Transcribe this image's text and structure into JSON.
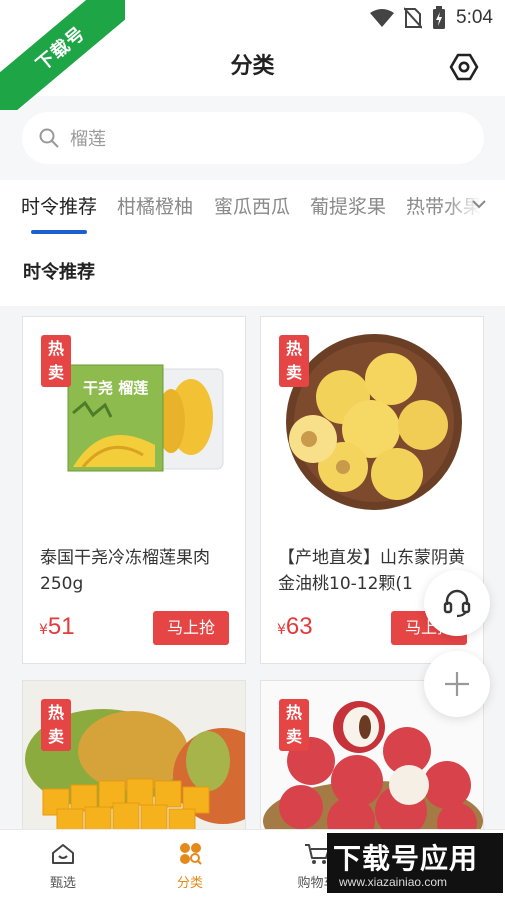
{
  "status_bar": {
    "time": "5:04",
    "icons": [
      "wifi-icon",
      "no-sim-icon",
      "battery-charging-icon"
    ]
  },
  "corner_ribbon": {
    "text": "下载号"
  },
  "header": {
    "title": "分类",
    "settings_icon": "hexagon-settings-icon"
  },
  "search": {
    "placeholder": "榴莲",
    "icon": "search-icon"
  },
  "tabs": [
    {
      "label": "时令推荐",
      "active": true
    },
    {
      "label": "柑橘橙柚",
      "active": false
    },
    {
      "label": "蜜瓜西瓜",
      "active": false
    },
    {
      "label": "葡提浆果",
      "active": false
    },
    {
      "label": "热带水果",
      "active": false
    }
  ],
  "section": {
    "title": "时令推荐"
  },
  "products": [
    {
      "badge": "热卖",
      "name": "泰国干尧冷冻榴莲果肉250g",
      "currency": "¥",
      "price": "51",
      "button": "马上抢",
      "package_text": "干尧 榴莲"
    },
    {
      "badge": "热卖",
      "name": "【产地直发】山东蒙阴黄金油桃10-12颗(1",
      "currency": "¥",
      "price": "63",
      "button": "马上抢"
    },
    {
      "badge": "热卖"
    },
    {
      "badge": "热卖"
    }
  ],
  "floating": {
    "service_icon": "headset-icon",
    "add_icon": "plus-icon"
  },
  "bottom_nav": [
    {
      "label": "甄选",
      "icon": "home-icon",
      "active": false
    },
    {
      "label": "分类",
      "icon": "category-grid-icon",
      "active": true
    },
    {
      "label": "购物车",
      "icon": "cart-icon",
      "active": false
    }
  ],
  "watermark": {
    "title": "下载号应用",
    "url": "www.xiazainiao.com"
  },
  "colors": {
    "accent_red": "#e54545",
    "tab_indicator": "#1b5fd1",
    "nav_active": "#e48a1a",
    "ribbon_green": "#1ea546"
  }
}
